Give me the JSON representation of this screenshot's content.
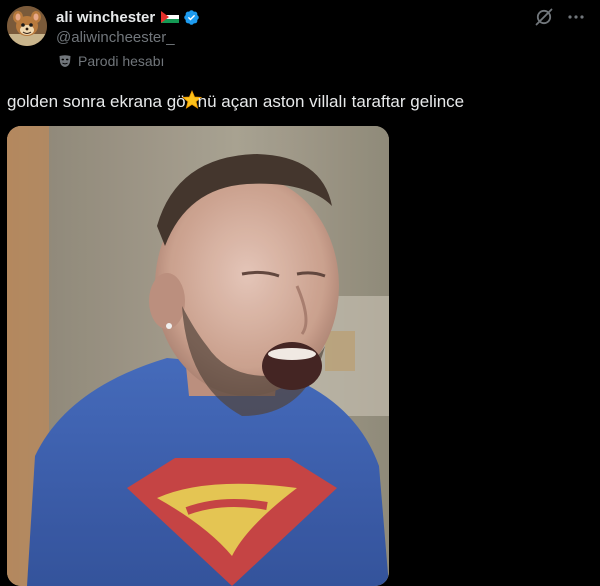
{
  "tweet": {
    "author": {
      "display_name": "ali winchester",
      "handle": "@aliwincheester_",
      "flag_icon": "palestine-flag-icon",
      "verified_icon": "verified-badge-icon",
      "verified_color": "#1d9bf0"
    },
    "parody_label": "Parodi hesabı",
    "text_before_emoji": "golden sonra ekrana gö",
    "emoji": "star-emoji",
    "text_after_emoji": "nü açan aston villalı taraftar gelince",
    "actions": {
      "grok_icon": "grok-icon",
      "more_icon": "more-options-icon"
    },
    "media": {
      "type": "video-frame"
    }
  },
  "colors": {
    "background": "#000000",
    "primary_text": "#e7e9ea",
    "secondary_text": "#71767b",
    "accent": "#1d9bf0"
  }
}
